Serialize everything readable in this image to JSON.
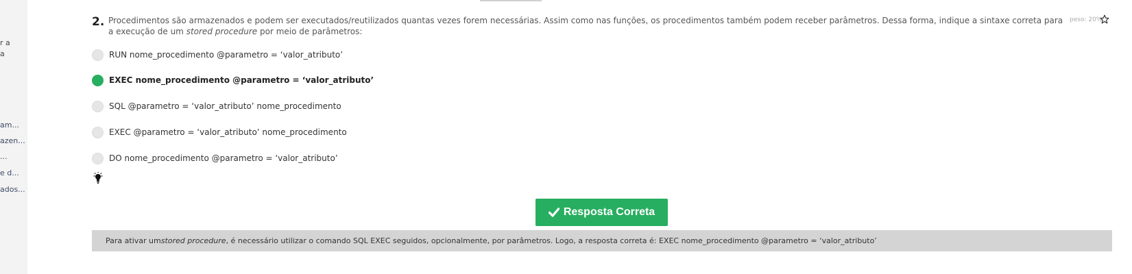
{
  "sidebar": {
    "fragments": [
      {
        "text": "r a"
      },
      {
        "text": "a"
      },
      {
        "text": "am..."
      },
      {
        "text": "azen..."
      },
      {
        "text": "..."
      },
      {
        "text": "e d..."
      },
      {
        "text": "ados..."
      }
    ]
  },
  "question": {
    "number": "2.",
    "text_before": "Procedimentos são armazenados e podem ser executados/reutilizados quantas vezes forem necessárias. Assim como nas funções, os procedimentos também podem receber parâmetros. Dessa forma, indique a sintaxe correta para a execução de um ",
    "text_emphasis": "stored procedure",
    "text_after": " por meio de parâmetros:",
    "weight": "peso: 20%",
    "options": [
      {
        "label": "RUN nome_procedimento @parametro = ‘valor_atributo’",
        "selected": false
      },
      {
        "label": "EXEC nome_procedimento @parametro = ‘valor_atributo’",
        "selected": true
      },
      {
        "label": "SQL @parametro = ‘valor_atributo’ nome_procedimento",
        "selected": false
      },
      {
        "label": "EXEC @parametro = ‘valor_atributo’ nome_procedimento",
        "selected": false
      },
      {
        "label": "DO nome_procedimento @parametro = ‘valor_atributo’",
        "selected": false
      }
    ]
  },
  "result_button": {
    "label": "Resposta Correta"
  },
  "explanation": {
    "before": "Para ativar um ",
    "emphasis": "stored procedure",
    "after": ", é necessário utilizar o comando SQL EXEC seguidos, opcionalmente, por parâmetros. Logo, a resposta correta é: EXEC nome_procedimento @parametro = ‘valor_atributo’"
  },
  "colors": {
    "accent_green": "#27ae60",
    "explanation_bg": "#d4d4d4",
    "sidebar_bg": "#f3f3f3"
  },
  "icons": {
    "star": "star-icon",
    "bulb": "lightbulb-icon",
    "check": "check-icon"
  }
}
